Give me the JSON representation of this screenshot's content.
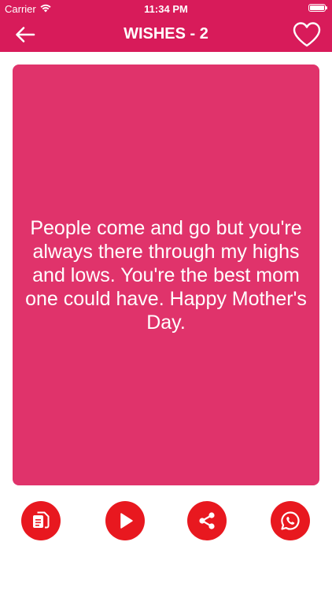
{
  "status_bar": {
    "carrier": "Carrier",
    "time": "11:34 PM"
  },
  "nav": {
    "title": "WISHES - 2"
  },
  "wish": {
    "text": "People come and go but you're always there through my highs and lows. You're the best mom one could have. Happy Mother's Day."
  },
  "actions": {
    "icons": [
      "copy-icon",
      "play-icon",
      "share-icon",
      "whatsapp-icon"
    ]
  },
  "colors": {
    "header": "#d81b5a",
    "card": "#e0336b",
    "action_button": "#e8181f"
  }
}
